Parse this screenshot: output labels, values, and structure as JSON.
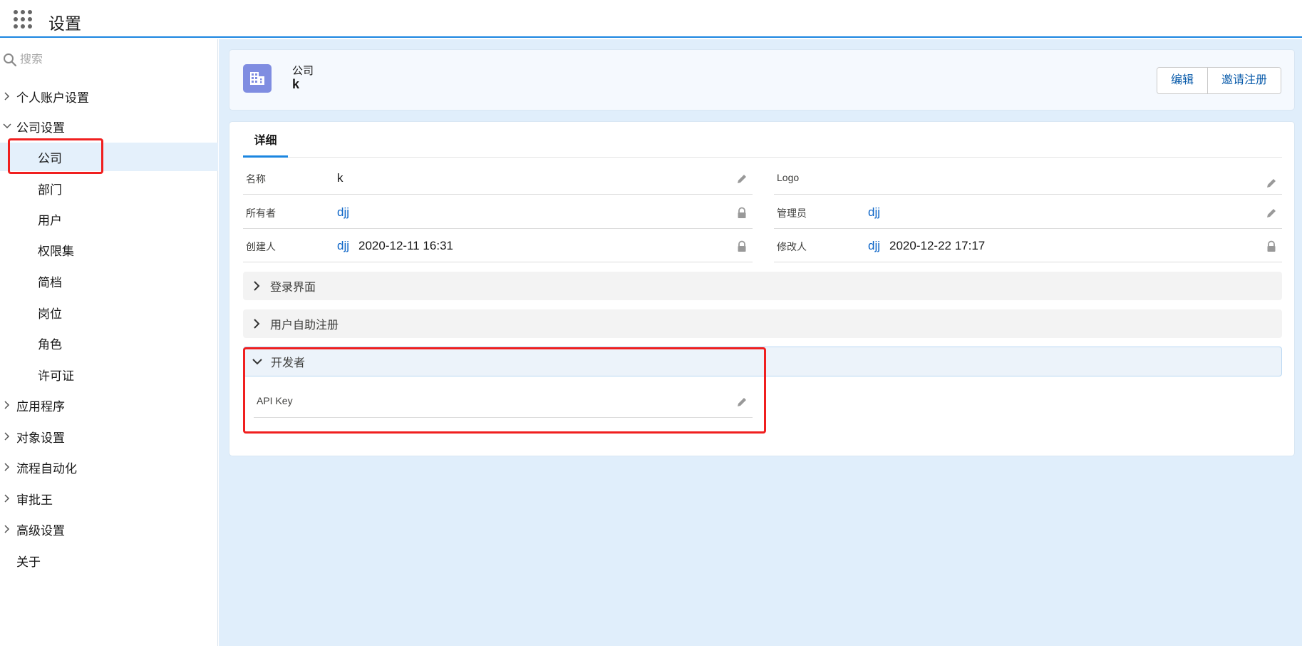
{
  "topbar": {
    "title": "设置",
    "launcher_icon": "app-launcher-icon"
  },
  "sidebar": {
    "search": {
      "placeholder": "搜索"
    },
    "groups": {
      "personal": "个人账户设置",
      "company": "公司设置",
      "apps": "应用程序",
      "objects": "对象设置",
      "flow": "流程自动化",
      "approval": "审批王",
      "advanced": "高级设置",
      "about": "关于"
    },
    "company_items": [
      "公司",
      "部门",
      "用户",
      "权限集",
      "简档",
      "岗位",
      "角色",
      "许可证"
    ],
    "active_item": "公司"
  },
  "header": {
    "eyebrow": "公司",
    "name": "k",
    "icon": "building-icon",
    "buttons": {
      "edit": "编辑",
      "invite": "邀请注册"
    }
  },
  "tabs": {
    "details": "详细"
  },
  "fields": {
    "name": {
      "label": "名称",
      "value": "k"
    },
    "logo": {
      "label": "Logo",
      "value": ""
    },
    "owner": {
      "label": "所有者",
      "value": "djj"
    },
    "admin": {
      "label": "管理员",
      "value": "djj"
    },
    "creator": {
      "label": "创建人",
      "user": "djj",
      "time": "2020-12-11 16:31"
    },
    "modifier": {
      "label": "修改人",
      "user": "djj",
      "time": "2020-12-22 17:17"
    },
    "api_key": {
      "label": "API Key",
      "value": ""
    }
  },
  "sections": {
    "login": "登录界面",
    "self_register": "用户自助注册",
    "developer": "开发者"
  },
  "colors": {
    "accent": "#1b86e0",
    "link": "#0b64c7",
    "highlight_box": "#f01f1f",
    "main_bg": "#e0eefb",
    "icon_bg": "#7f8de1"
  }
}
